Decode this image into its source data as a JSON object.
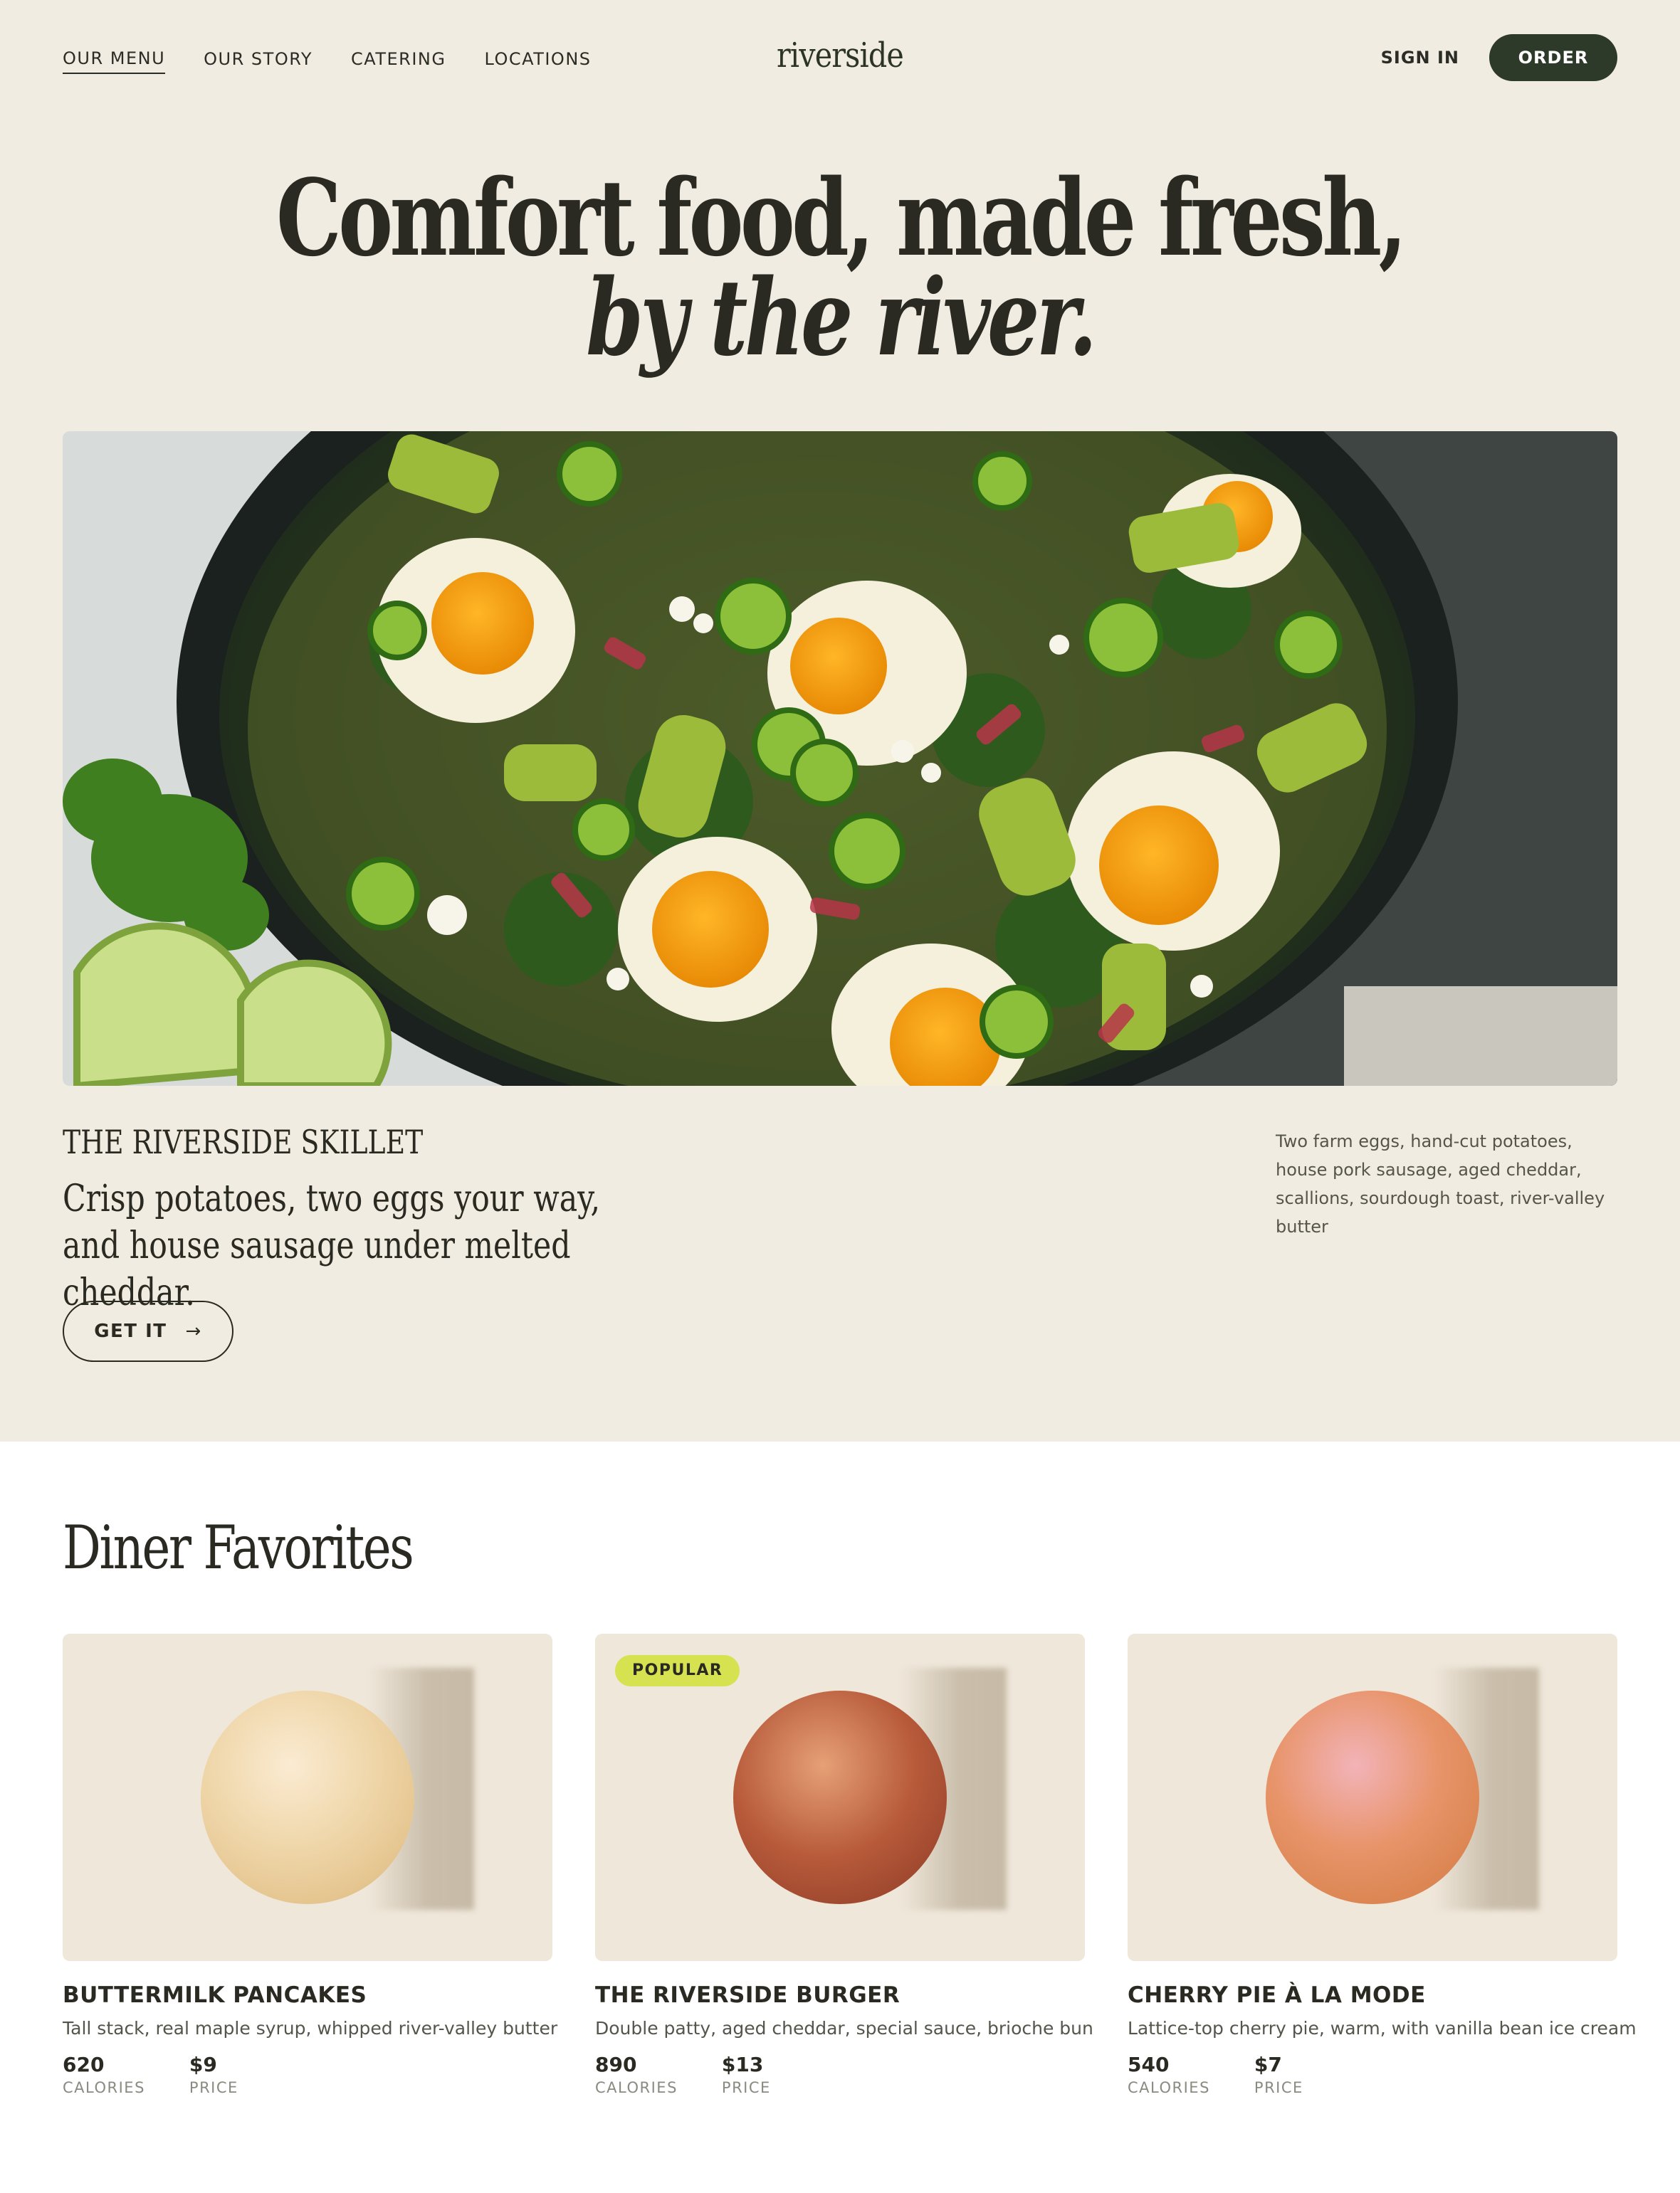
{
  "nav": {
    "links": [
      "OUR MENU",
      "OUR STORY",
      "CATERING",
      "LOCATIONS"
    ],
    "logo": "riverside",
    "sign_in": "SIGN IN",
    "order": "ORDER"
  },
  "hero": {
    "headline_line1": "Comfort food, made fresh,",
    "headline_line2": "by the river.",
    "kicker": "THE RIVERSIDE SKILLET",
    "description": "Crisp potatoes, two eggs your way, and house sausage under melted cheddar.",
    "details": "Two farm eggs, hand-cut potatoes, house pork sausage, aged cheddar, scallions, sourdough toast, river-valley butter",
    "cta": "GET IT",
    "cta_icon": "arrow-right-icon"
  },
  "favorites": {
    "title": "Diner Favorites",
    "calories_label": "CALORIES",
    "price_label": "PRICE",
    "items": [
      {
        "name": "BUTTERMILK PANCAKES",
        "description": "Tall stack, real maple syrup, whipped river-valley butter",
        "calories": "620",
        "price": "$9",
        "badge": "",
        "color": "#e8cf9e"
      },
      {
        "name": "THE RIVERSIDE BURGER",
        "description": "Double patty, aged cheddar, special sauce, brioche bun",
        "calories": "890",
        "price": "$13",
        "badge": "POPULAR",
        "color": "#a24a30"
      },
      {
        "name": "CHERRY PIE À LA MODE",
        "description": "Lattice-top cherry pie, warm, with vanilla bean ice cream",
        "calories": "540",
        "price": "$7",
        "badge": "",
        "color": "#e08b5a"
      }
    ]
  }
}
